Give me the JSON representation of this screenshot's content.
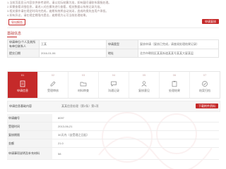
{
  "notes": [
    "1.当前页面显示内容仅供参考说明，请以实际结算为准，如有疑问请联系客服处理。",
    "2.如需查看详细信息，请进入对应模块进行查看，相关数据以系统记录为准。",
    "3.相关操作请在规定时间内完成，逾期系统将自动关闭，造成的损失由用户承担。",
    "4.如有异议，请在规定期限内提出，逾期视为认可当前处理结果。"
  ],
  "header": {
    "outline_button": "导出报告",
    "solid_button": "申请复核"
  },
  "section_title": "基础信息",
  "info_rows": [
    [
      "申请单位/个人及其所有单位联系人",
      "王某",
      "申请类型",
      "复核申请（复核已完成，请查阅处理结果记录）"
    ],
    [
      "提交日期",
      "2016-01-06",
      "地址",
      "北京市朝阳区某某街道某某号某某大厦某层"
    ]
  ],
  "tabs": [
    {
      "num": "01",
      "icon": "document-icon",
      "label": "申请信息",
      "active": true
    },
    {
      "num": "02",
      "icon": "edit-icon",
      "label": "受理审核",
      "active": false
    },
    {
      "num": "03",
      "icon": "folder-icon",
      "label": "材料审查",
      "active": false
    },
    {
      "num": "04",
      "icon": "chat-icon",
      "label": "沟通记录",
      "active": false
    },
    {
      "num": "05",
      "icon": "user-icon",
      "label": "复核意见",
      "active": false
    },
    {
      "num": "06",
      "icon": "clipboard-icon",
      "label": "处理结果",
      "active": false
    },
    {
      "num": "07",
      "icon": "check-icon",
      "label": "结案归档",
      "active": false
    }
  ],
  "sub_bar": {
    "label": "申请信息基础内容",
    "value": "某某信息处理（第2条）第1项",
    "button": "下载附件资料"
  },
  "detail_rows": [
    {
      "label": "申请编号",
      "value": "8097",
      "tall": false
    },
    {
      "label": "受理时间",
      "value": "2013-06-21",
      "tall": false
    },
    {
      "label": "复核期限",
      "value": "30天内（自受理之日起）",
      "tall": false
    },
    {
      "label": "金额",
      "value": "21.0",
      "tall": false
    },
    {
      "label": "申请事项说明及补充材料",
      "value": "58",
      "tall": true
    }
  ],
  "colors": {
    "accent": "#c52a2a"
  }
}
